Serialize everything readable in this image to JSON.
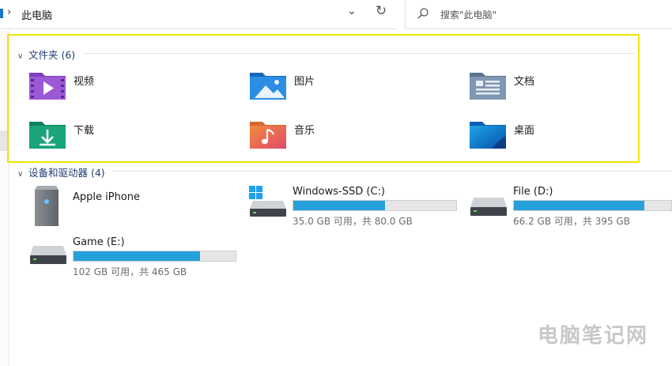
{
  "address": {
    "path": "此电脑"
  },
  "search": {
    "placeholder": "搜索\"此电脑\""
  },
  "folders_section": {
    "title": "文件夹 (6)",
    "items": [
      {
        "label": "视频",
        "icon": "videos-folder-icon"
      },
      {
        "label": "图片",
        "icon": "pictures-folder-icon"
      },
      {
        "label": "文档",
        "icon": "documents-folder-icon"
      },
      {
        "label": "下载",
        "icon": "downloads-folder-icon"
      },
      {
        "label": "音乐",
        "icon": "music-folder-icon"
      },
      {
        "label": "桌面",
        "icon": "desktop-folder-icon"
      }
    ]
  },
  "drives_section": {
    "title": "设备和驱动器 (4)",
    "items": [
      {
        "name": "Apple iPhone",
        "icon": "phone-device-icon"
      },
      {
        "name": "Windows-SSD (C:)",
        "size_text": "35.0 GB 可用，共 80.0 GB",
        "used_fraction": 0.5625,
        "icon": "system-drive-icon"
      },
      {
        "name": "File (D:)",
        "size_text": "66.2 GB 可用，共 395 GB",
        "used_fraction": 0.83,
        "icon": "drive-icon"
      },
      {
        "name": "Game (E:)",
        "size_text": "102 GB 可用，共 465 GB",
        "used_fraction": 0.78,
        "icon": "drive-icon"
      }
    ]
  },
  "colors": {
    "highlight_border": "#f2e400",
    "bar_fill": "#26a0da",
    "section_heading": "#1f3d77"
  },
  "watermark": "电脑笔记网"
}
